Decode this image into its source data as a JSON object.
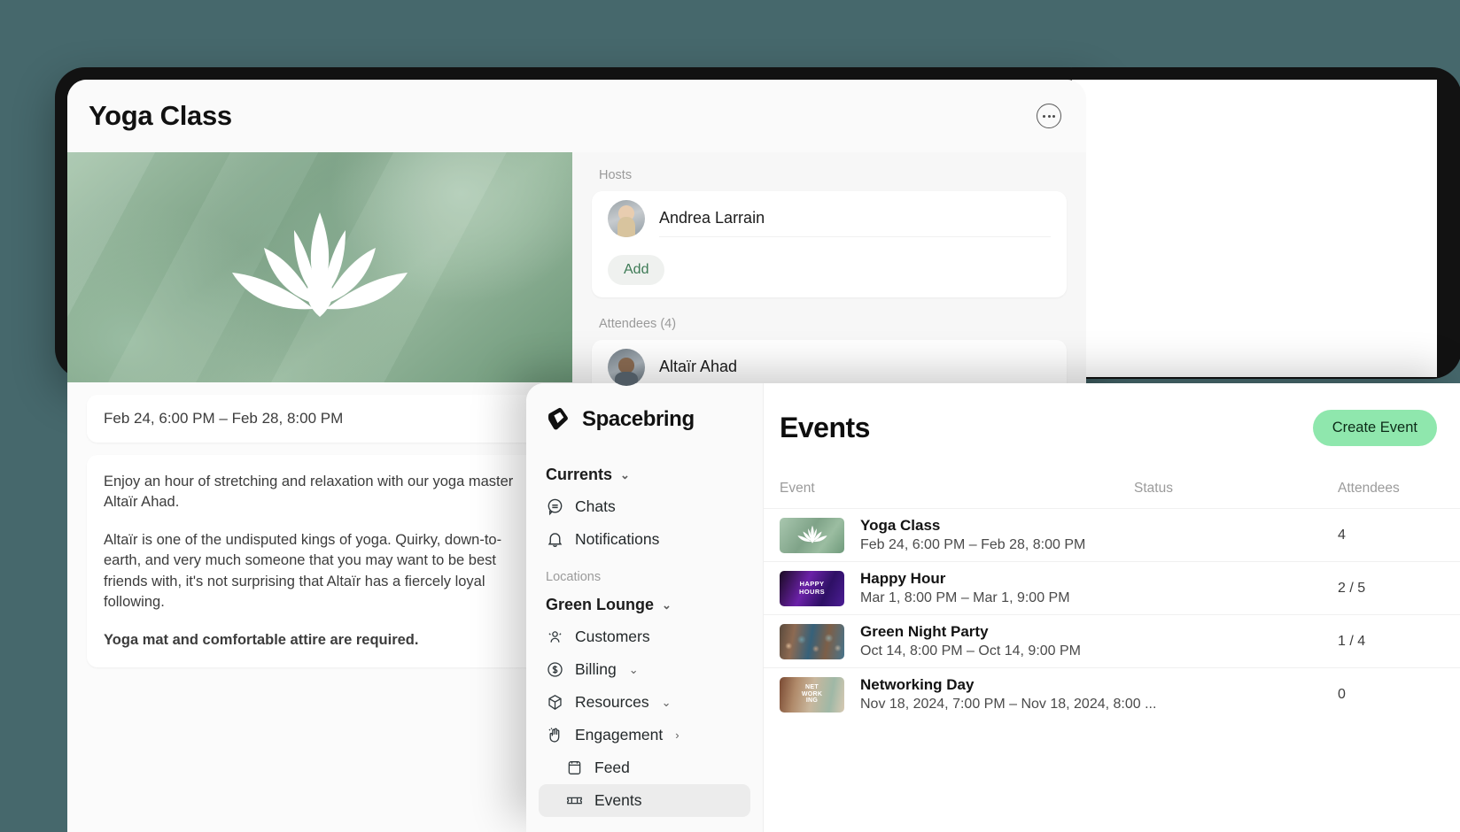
{
  "background": {
    "color": "#46686c"
  },
  "detail": {
    "title": "Yoga Class",
    "more_icon": "ellipsis-icon",
    "date_range": "Feb 24, 6:00 PM – Feb 28, 8:00 PM",
    "description": [
      "Enjoy an hour of stretching and relaxation with our yoga master Altaïr Ahad.",
      "Altaïr is one of the undisputed kings of yoga. Quirky, down-to-earth, and very much someone that you may want to be best friends with, it's not surprising that Altaïr has a fiercely loyal following."
    ],
    "description_bold": "Yoga mat and comfortable attire are required.",
    "hero_icon": "lotus-icon",
    "hosts_label": "Hosts",
    "hosts": [
      {
        "name": "Andrea Larrain"
      }
    ],
    "add_label": "Add",
    "attendees_label": "Attendees (4)",
    "attendees": [
      {
        "name": "Altaïr Ahad"
      }
    ]
  },
  "sidebar": {
    "brand": "Spacebring",
    "brand_icon": "spacebring-cube-logo",
    "currents": {
      "label": "Currents",
      "chevron": "⌄"
    },
    "currents_items": [
      {
        "label": "Chats",
        "icon": "chat-bubble-icon"
      },
      {
        "label": "Notifications",
        "icon": "bell-icon"
      }
    ],
    "locations_label": "Locations",
    "location": {
      "label": "Green Lounge",
      "chevron": "⌄"
    },
    "location_items": [
      {
        "label": "Customers",
        "icon": "people-icon",
        "chevron": ""
      },
      {
        "label": "Billing",
        "icon": "dollar-circle-icon",
        "chevron": "⌄"
      },
      {
        "label": "Resources",
        "icon": "cube-icon",
        "chevron": "⌄"
      },
      {
        "label": "Engagement",
        "icon": "wave-hand-icon",
        "chevron": "›"
      }
    ],
    "engagement_children": [
      {
        "label": "Feed",
        "icon": "feed-icon",
        "active": false
      },
      {
        "label": "Events",
        "icon": "ticket-icon",
        "active": true
      }
    ]
  },
  "main": {
    "page_title": "Events",
    "create_button": "Create Event",
    "columns": {
      "event": "Event",
      "status": "Status",
      "attendees": "Attendees"
    },
    "rows": [
      {
        "name": "Yoga Class",
        "date": "Feb 24, 6:00 PM – Feb 28, 8:00 PM",
        "status": "",
        "attendees": "4",
        "thumb": "yoga-thumbnail"
      },
      {
        "name": "Happy Hour",
        "date": "Mar 1, 8:00 PM – Mar 1, 9:00 PM",
        "status": "",
        "attendees": "2 / 5",
        "thumb": "happy-hour-thumbnail",
        "thumb_text_1": "HAPPY",
        "thumb_text_2": "HOURS"
      },
      {
        "name": "Green Night Party",
        "date": "Oct 14, 8:00 PM – Oct 14, 9:00 PM",
        "status": "",
        "attendees": "1 / 4",
        "thumb": "party-thumbnail"
      },
      {
        "name": "Networking Day",
        "date": "Nov 18, 2024, 7:00 PM – Nov 18, 2024, 8:00 ...",
        "status": "",
        "attendees": "0",
        "thumb": "networking-thumbnail",
        "thumb_text_1": "NET",
        "thumb_text_2": "WORK",
        "thumb_text_3": "ING"
      }
    ]
  },
  "colors": {
    "accent_green": "#8fe7ad",
    "add_text": "#3d7a55",
    "active_nav_bg": "#ececec"
  }
}
